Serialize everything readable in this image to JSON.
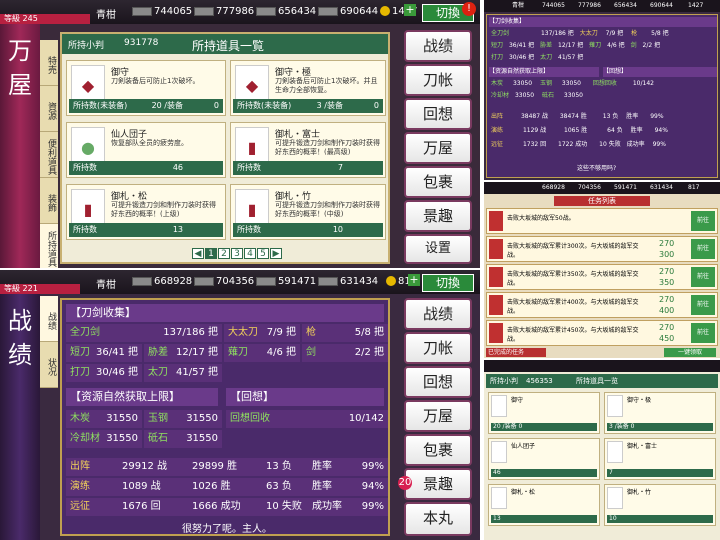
{
  "topbar_main": {
    "user": "青柑",
    "level": "等級 245",
    "res1": "744065",
    "res2": "777986",
    "res3": "656434",
    "res4": "690644",
    "coins": "1427",
    "switch_label": "切換"
  },
  "panel_items": {
    "title": "万屋",
    "gold_label": "所持小判",
    "gold_value": "931778",
    "header": "所持道具一覧",
    "sidetabs": [
      "特売",
      "資源",
      "便利道具",
      "装飾",
      "所持道具"
    ],
    "items": [
      {
        "name": "御守",
        "desc": "刀剣装备后可防止1次破坏。",
        "count_label": "所持数(未装备)",
        "count": "20 /装备",
        "use": "0"
      },
      {
        "name": "御守・極",
        "desc": "刀剣装备后可防止1次破坏。并且生命力全部恢复。",
        "count_label": "所持数(未装备)",
        "count": "3 /装备",
        "use": "0"
      },
      {
        "name": "仙人団子",
        "desc": "恢复部队全员的疲劳度。",
        "count_label": "所持数",
        "count": "46",
        "use": ""
      },
      {
        "name": "御札・富士",
        "desc": "可提升锻造刀剑和制作刀装时获得好东西的概率！(最高级)",
        "count_label": "所持数",
        "count": "7",
        "use": ""
      },
      {
        "name": "御札・松",
        "desc": "可提升锻造刀剑和制作刀装时获得好东西的概率！(上级)",
        "count_label": "所持数",
        "count": "13",
        "use": ""
      },
      {
        "name": "御札・竹",
        "desc": "可提升锻造刀剑和制作刀装时获得好东西的概率！(中级)",
        "count_label": "所持数",
        "count": "10",
        "use": ""
      }
    ],
    "pages": [
      "1",
      "2",
      "3",
      "4",
      "5"
    ]
  },
  "right_buttons": {
    "b1": "战绩",
    "b2": "刀帐",
    "b3": "回想",
    "b4": "万屋",
    "b5": "包裹",
    "b6": "景趣",
    "b7": "设置",
    "b8": "公告",
    "b9": "本丸",
    "badge_top": "!",
    "badge_main": "23"
  },
  "topbar_stats": {
    "user": "青柑",
    "level": "等級 221",
    "res1": "668928",
    "res2": "704356",
    "res3": "591471",
    "res4": "631434",
    "coins": "817",
    "switch_label": "切換"
  },
  "panel_stats": {
    "title": "战绩",
    "sidetabs": [
      "战绩",
      "状况"
    ],
    "sec_sword": "【刀剑收集】",
    "swords": [
      {
        "label": "全刀剑",
        "value": "137/186 把"
      },
      {
        "label": "大太刀",
        "value": "7/9 把"
      },
      {
        "label": "枪",
        "value": "5/8 把"
      },
      {
        "label": "短刀",
        "value": "36/41 把"
      },
      {
        "label": "胁差",
        "value": "12/17 把"
      },
      {
        "label": "薙刀",
        "value": "4/6 把"
      },
      {
        "label": "剑",
        "value": "2/2 把"
      },
      {
        "label": "打刀",
        "value": "30/46 把"
      },
      {
        "label": "太刀",
        "value": "41/57 把"
      }
    ],
    "sec_res": "【资源自然获取上限】",
    "sec_recall": "【回想】",
    "res": [
      {
        "label": "木炭",
        "value": "31550"
      },
      {
        "label": "玉钢",
        "value": "31550"
      },
      {
        "label": "冷却材",
        "value": "31550"
      },
      {
        "label": "砥石",
        "value": "31550"
      }
    ],
    "recall_label": "回想回收",
    "recall_value": "10/142",
    "battle": [
      {
        "label": "出阵",
        "a": "29912 战",
        "b": "29899 胜",
        "c": "13 负",
        "d": "胜率",
        "e": "99%"
      },
      {
        "label": "演练",
        "a": "1089 战",
        "b": "1026 胜",
        "c": "63 负",
        "d": "胜率",
        "e": "94%"
      },
      {
        "label": "远征",
        "a": "1676 回",
        "b": "1666 成功",
        "c": "10 失败",
        "d": "成功率",
        "e": "99%"
      }
    ],
    "footer": "很努力了呢。主人。",
    "badge": "20"
  },
  "mini_tr": {
    "user": "青柑",
    "res1": "744065",
    "res2": "777986",
    "res3": "656434",
    "res4": "690644",
    "coins": "1427",
    "sec1": "【刀剑收集】",
    "swords": [
      [
        "全刀剑",
        "137/186 把",
        "大太刀",
        "7/9 把",
        "枪",
        "5/8 把"
      ],
      [
        "短刀",
        "36/41 把",
        "胁差",
        "12/17 把",
        "薙刀",
        "4/6 把",
        "剑",
        "2/2 把"
      ],
      [
        "打刀",
        "30/46 把",
        "太刀",
        "41/57 把"
      ]
    ],
    "sec2": "【资源自然获取上限】",
    "sec3": "【回想】",
    "res": [
      "木炭",
      "33050",
      "玉钢",
      "33050",
      "回想回收",
      "10/142",
      "冷却材",
      "33050",
      "砥石",
      "33050"
    ],
    "battle": [
      [
        "出阵",
        "38487 战",
        "38474 胜",
        "13 负",
        "胜率",
        "99%"
      ],
      [
        "演练",
        "1129 战",
        "1065 胜",
        "64 负",
        "胜率",
        "94%"
      ],
      [
        "远征",
        "1732 回",
        "1722 成功",
        "10 失败",
        "成功率",
        "99%"
      ]
    ],
    "footer": "这些不够用吗?"
  },
  "mini_mr": {
    "res1": "668928",
    "res2": "704356",
    "res3": "591471",
    "res4": "631434",
    "coins": "817",
    "header": "任务列表",
    "rows": [
      {
        "text": "击败大坂城的敌军50战。",
        "a": "",
        "b": "",
        "btn": "前往"
      },
      {
        "text": "击败大坂城的敌军累计300次。与大坂城的敌军交战。",
        "a": "270",
        "b": "300",
        "btn": "前往"
      },
      {
        "text": "击败大坂城的敌军累计350次。与大坂城的敌军交战。",
        "a": "270",
        "b": "350",
        "btn": "前往"
      },
      {
        "text": "击败大坂城的敌军累计400次。与大坂城的敌军交战。",
        "a": "270",
        "b": "400",
        "btn": "前往"
      },
      {
        "text": "击败大坂城的敌军累计450次。与大坂城的敌军交战。",
        "a": "270",
        "b": "450",
        "btn": "前往"
      }
    ],
    "footer_left": "已完成的任务",
    "footer_right": "一键领取"
  },
  "mini_br": {
    "gold_label": "所持小判",
    "gold_value": "456353",
    "header": "所持道具一览",
    "items": [
      {
        "name": "御守",
        "count": "20 /装备 0"
      },
      {
        "name": "御守・极",
        "count": "3 /装备 0"
      },
      {
        "name": "仙人团子",
        "count": "46"
      },
      {
        "name": "御札・富士",
        "count": "7"
      },
      {
        "name": "御札・松",
        "count": "13"
      },
      {
        "name": "御札・竹",
        "count": "10"
      }
    ]
  }
}
